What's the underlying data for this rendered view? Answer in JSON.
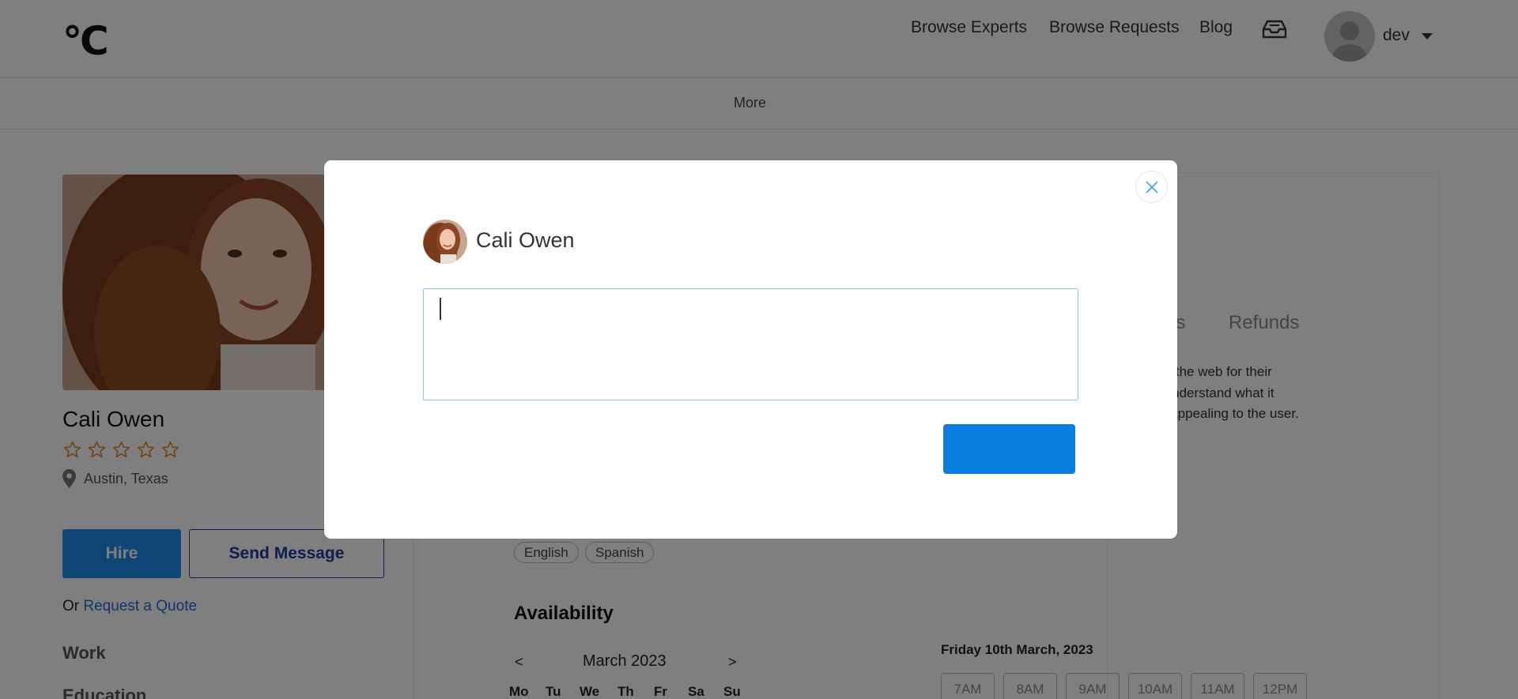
{
  "header": {
    "logo": "°C",
    "nav": [
      "Browse Experts",
      "Browse Requests",
      "Blog"
    ],
    "user_name": "dev"
  },
  "subnav": {
    "more": "More"
  },
  "profile": {
    "name": "Cali Owen",
    "rating_stars": 0,
    "rating_max": 5,
    "location": "Austin, Texas",
    "hire_label": "Hire",
    "message_label": "Send Message",
    "quote_prefix": "Or",
    "quote_link": "Request a Quote",
    "sections": [
      "Work",
      "Education"
    ]
  },
  "content": {
    "tabs_visible": [
      "ws",
      "Refunds"
    ],
    "about_lines": [
      "y on the web for their",
      "ey understand what it",
      "ally appealing to the user."
    ],
    "languages": [
      "English",
      "Spanish"
    ],
    "availability_heading": "Availability",
    "calendar": {
      "prev": "<",
      "next": ">",
      "month": "March 2023",
      "weekdays": [
        "Mo",
        "Tu",
        "We",
        "Th",
        "Fr",
        "Sa",
        "Su"
      ]
    },
    "selected_date": "Friday 10th March, 2023",
    "time_slots": [
      "7AM",
      "8AM",
      "9AM",
      "10AM",
      "11AM",
      "12PM"
    ]
  },
  "modal": {
    "recipient_name": "Cali Owen",
    "message_value": "",
    "send_label": ""
  },
  "colors": {
    "primary": "#1f8ded",
    "send_button": "#0a7ee0",
    "link": "#1f6fd1",
    "outline_button": "#1a3fa0",
    "star": "#e08a2c",
    "overlay": "rgba(0,0,0,0.5)"
  }
}
